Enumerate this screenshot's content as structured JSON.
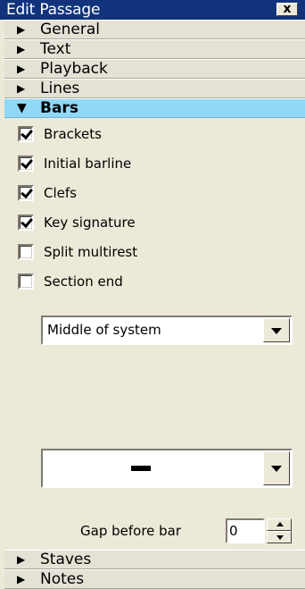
{
  "window": {
    "title": "Edit Passage",
    "close_glyph": "x"
  },
  "sections_top": [
    {
      "label": "General",
      "icon": "triangle-right-icon"
    },
    {
      "label": "Text",
      "icon": "triangle-right-icon"
    },
    {
      "label": "Playback",
      "icon": "triangle-right-icon"
    },
    {
      "label": "Lines",
      "icon": "triangle-right-icon"
    }
  ],
  "active_section": {
    "label": "Bars",
    "icon": "triangle-down-icon",
    "color": "#91d8f7"
  },
  "checkboxes": [
    {
      "label": "Brackets",
      "checked": true
    },
    {
      "label": "Initial barline",
      "checked": true
    },
    {
      "label": "Clefs",
      "checked": true
    },
    {
      "label": "Key signature",
      "checked": true
    },
    {
      "label": "Split multirest",
      "checked": false
    },
    {
      "label": "Section end",
      "checked": false
    }
  ],
  "position_select": {
    "value": "Middle of system"
  },
  "barline_select": {
    "value": "normal-barline-glyph"
  },
  "gap": {
    "label": "Gap before bar",
    "value": "0"
  },
  "sections_bottom": [
    {
      "label": "Staves",
      "icon": "triangle-right-icon"
    },
    {
      "label": "Notes",
      "icon": "triangle-right-icon"
    }
  ]
}
